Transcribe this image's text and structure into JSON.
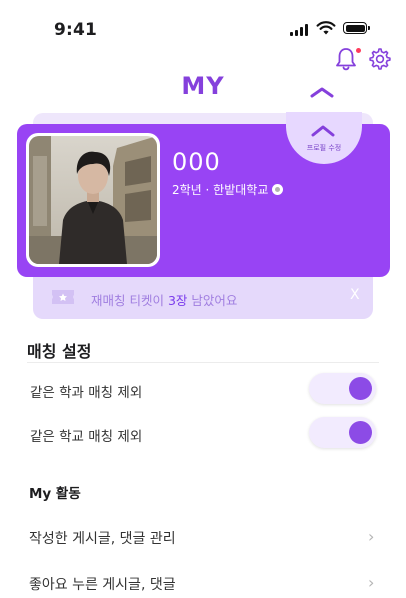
{
  "status_bar": {
    "time": "9:41"
  },
  "header": {
    "title": "MY"
  },
  "profile": {
    "tab_label": "프로필 수정",
    "name": "000",
    "detail": "2학년 · 한밭대학교"
  },
  "ticket": {
    "text_before": "재매칭 티켓이 ",
    "count": "3장",
    "text_after": " 남았어요",
    "close": "X"
  },
  "matching": {
    "section_title": "매칭 설정",
    "toggles": [
      {
        "label": "같은 학과 매칭 제외",
        "on": true
      },
      {
        "label": "같은 학교 매칭 제외",
        "on": true
      }
    ]
  },
  "activity": {
    "section_title": "My 활동",
    "items": [
      {
        "label": "작성한 게시글, 댓글 관리"
      },
      {
        "label": "좋아요 누른 게시글, 댓글"
      }
    ]
  },
  "colors": {
    "accent": "#9844f4",
    "title": "#8540dc",
    "toggle_knob": "#8c4be6"
  }
}
